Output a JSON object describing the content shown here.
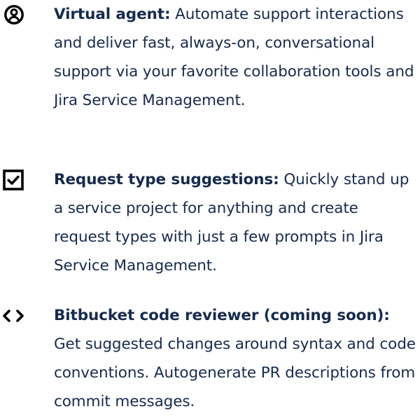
{
  "features": [
    {
      "icon": "agent-icon",
      "title": "Virtual agent:",
      "body": " Automate support interactions and deliver fast, always-on, conversational support via your favorite collaboration tools and Jira Service Management."
    },
    {
      "icon": "checkbox-icon",
      "title": "Request type suggestions:",
      "body": " Quickly stand up a service project for anything and create request types with just a few prompts in Jira Service Management."
    },
    {
      "icon": "code-icon",
      "title": "Bitbucket code reviewer (coming soon):",
      "body": " Get suggested changes around syntax and code conventions. Autogenerate PR descriptions from commit messages."
    }
  ],
  "colors": {
    "text": "#172b4d",
    "icon": "#000000",
    "background": "#ffffff"
  }
}
